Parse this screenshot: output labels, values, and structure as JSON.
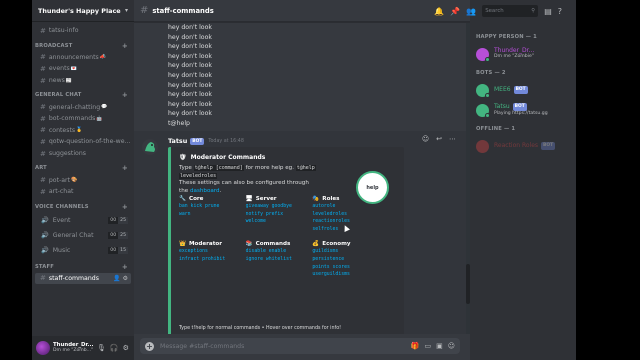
{
  "server": {
    "name": "Thunder's Happy Place"
  },
  "sidebar": {
    "top_channels": [
      {
        "name": "tatsu-info"
      }
    ],
    "categories": [
      {
        "name": "BROADCAST",
        "channels": [
          {
            "name": "announcements",
            "emoji": "📣"
          },
          {
            "name": "events",
            "emoji": "💌"
          },
          {
            "name": "news",
            "emoji": "📰"
          }
        ]
      },
      {
        "name": "GENERAL CHAT",
        "channels": [
          {
            "name": "general-chatting",
            "emoji": "💬"
          },
          {
            "name": "bot-commands",
            "emoji": "🤖"
          },
          {
            "name": "contests",
            "emoji": "🥇"
          },
          {
            "name": "qotw-question-of-the-we...",
            "emoji": ""
          },
          {
            "name": "suggestions",
            "emoji": ""
          }
        ]
      },
      {
        "name": "ART",
        "channels": [
          {
            "name": "pot-art",
            "emoji": "🎨"
          },
          {
            "name": "art-chat",
            "emoji": ""
          }
        ]
      }
    ],
    "voice_category": "VOICE CHANNELS",
    "voice_channels": [
      {
        "name": "Event",
        "count": "00",
        "limit": "25"
      },
      {
        "name": "General Chat",
        "count": "00",
        "limit": "25"
      },
      {
        "name": "Music",
        "count": "00",
        "limit": "15"
      }
    ],
    "staff_category": "STAFF",
    "staff_channels": [
      {
        "name": "staff-commands"
      }
    ]
  },
  "userbar": {
    "name": "Thunder_Dr...",
    "status": "Dm me \"Zomb...\""
  },
  "channel": {
    "name": "staff-commands"
  },
  "search": {
    "placeholder": "Search"
  },
  "messages": {
    "spam_lines": [
      "hey don't look",
      "hey don't look",
      "hey don't look",
      "hey don't look",
      "hey don't look",
      "hey don't look",
      "hey don't look",
      "hey don't look",
      "hey don't look",
      "hey don't look",
      "t@help"
    ]
  },
  "tatsu_message": {
    "author": "Tatsu",
    "bot_tag": "BOT",
    "timestamp": "Today at 16:48",
    "embed": {
      "title": "Moderator Commands",
      "desc_prefix": "Type ",
      "desc_code1": "t@help [command]",
      "desc_mid": " for more help eg. ",
      "desc_code2": "t@help",
      "desc_code3": "leveledroles",
      "desc_line2_prefix": "These settings can also be configured through the ",
      "desc_link": "dashboard",
      "desc_line2_suffix": ".",
      "fields": [
        {
          "icon": "🔧",
          "name": "Core",
          "values": [
            "ban kick prune",
            "warn"
          ]
        },
        {
          "icon": "🖥",
          "name": "Server",
          "values": [
            "giveaway goodbye",
            "notify prefix",
            "welcome"
          ]
        },
        {
          "icon": "🎭",
          "name": "Roles",
          "values": [
            "autorole",
            "leveledroles",
            "reactionroles",
            "selfroles"
          ]
        },
        {
          "icon": "👑",
          "name": "Moderator",
          "values": [
            "exceptions",
            "infract prohibit"
          ]
        },
        {
          "icon": "📚",
          "name": "Commands",
          "values": [
            "disable enable",
            "ignore whitelist"
          ]
        },
        {
          "icon": "💰",
          "name": "Economy",
          "values": [
            "guildisms",
            "persistence",
            "points scores",
            "userguildisms"
          ]
        }
      ],
      "footer": "Type t!help for normal commands • Hover over commands for info!"
    },
    "overlay_label": "help"
  },
  "composer": {
    "placeholder": "Message #staff-commands"
  },
  "members": {
    "groups": [
      {
        "name": "HAPPY PERSON — 1",
        "members": [
          {
            "name": "Thunder_Dr...",
            "status": "Dm me \"Zombie\"",
            "color": "#b64fd8",
            "bot": false,
            "online": true
          }
        ]
      },
      {
        "name": "BOTS — 2",
        "members": [
          {
            "name": "MEE6",
            "status": "",
            "color": "#43b581",
            "bot": true,
            "online": true
          },
          {
            "name": "Tatsu",
            "status": "Playing https://tatsu.gg",
            "color": "#43b581",
            "bot": true,
            "online": true
          }
        ]
      },
      {
        "name": "OFFLINE — 1",
        "members": [
          {
            "name": "Reaction Roles",
            "status": "",
            "color": "#f04747",
            "bot": true,
            "online": false
          }
        ]
      }
    ]
  },
  "colors": {
    "accent": "#7289da",
    "online": "#43b581",
    "link": "#00b0f4",
    "embed_border": "#43b581"
  }
}
